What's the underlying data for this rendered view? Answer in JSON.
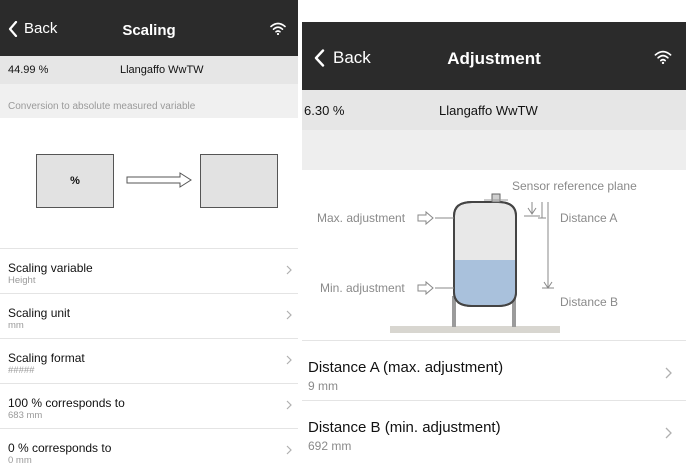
{
  "left_screen": {
    "nav": {
      "back_label": "Back",
      "title": "Scaling"
    },
    "status": {
      "percent": "44.99 %",
      "site": "Llangaffo WwTW"
    },
    "note": "Conversion to absolute measured variable",
    "diagram": {
      "percent_box_label": "%",
      "absolute_box_label": ""
    },
    "rows": [
      {
        "title": "Scaling variable",
        "value": "Height"
      },
      {
        "title": "Scaling unit",
        "value": "mm"
      },
      {
        "title": "Scaling format",
        "value": "#####"
      },
      {
        "title": "100 % corresponds to",
        "value": "683 mm"
      },
      {
        "title": "0 % corresponds to",
        "value": "0 mm"
      }
    ]
  },
  "right_screen": {
    "nav": {
      "back_label": "Back",
      "title": "Adjustment"
    },
    "status": {
      "percent": "6.30 %",
      "site": "Llangaffo WwTW"
    },
    "diagram": {
      "sensor_reference_plane": "Sensor reference plane",
      "max_adjustment": "Max. adjustment",
      "min_adjustment": "Min. adjustment",
      "distance_a": "Distance A",
      "distance_b": "Distance B"
    },
    "rows": [
      {
        "title": "Distance A (max. adjustment)",
        "value": "9 mm"
      },
      {
        "title": "Distance B (min. adjustment)",
        "value": "692 mm"
      }
    ]
  },
  "colors": {
    "navbar": "#2b2b2b",
    "status_bar": "#e6e6e6",
    "liquid": "#a9c1dc",
    "secondary_text": "#9a9a9a"
  }
}
